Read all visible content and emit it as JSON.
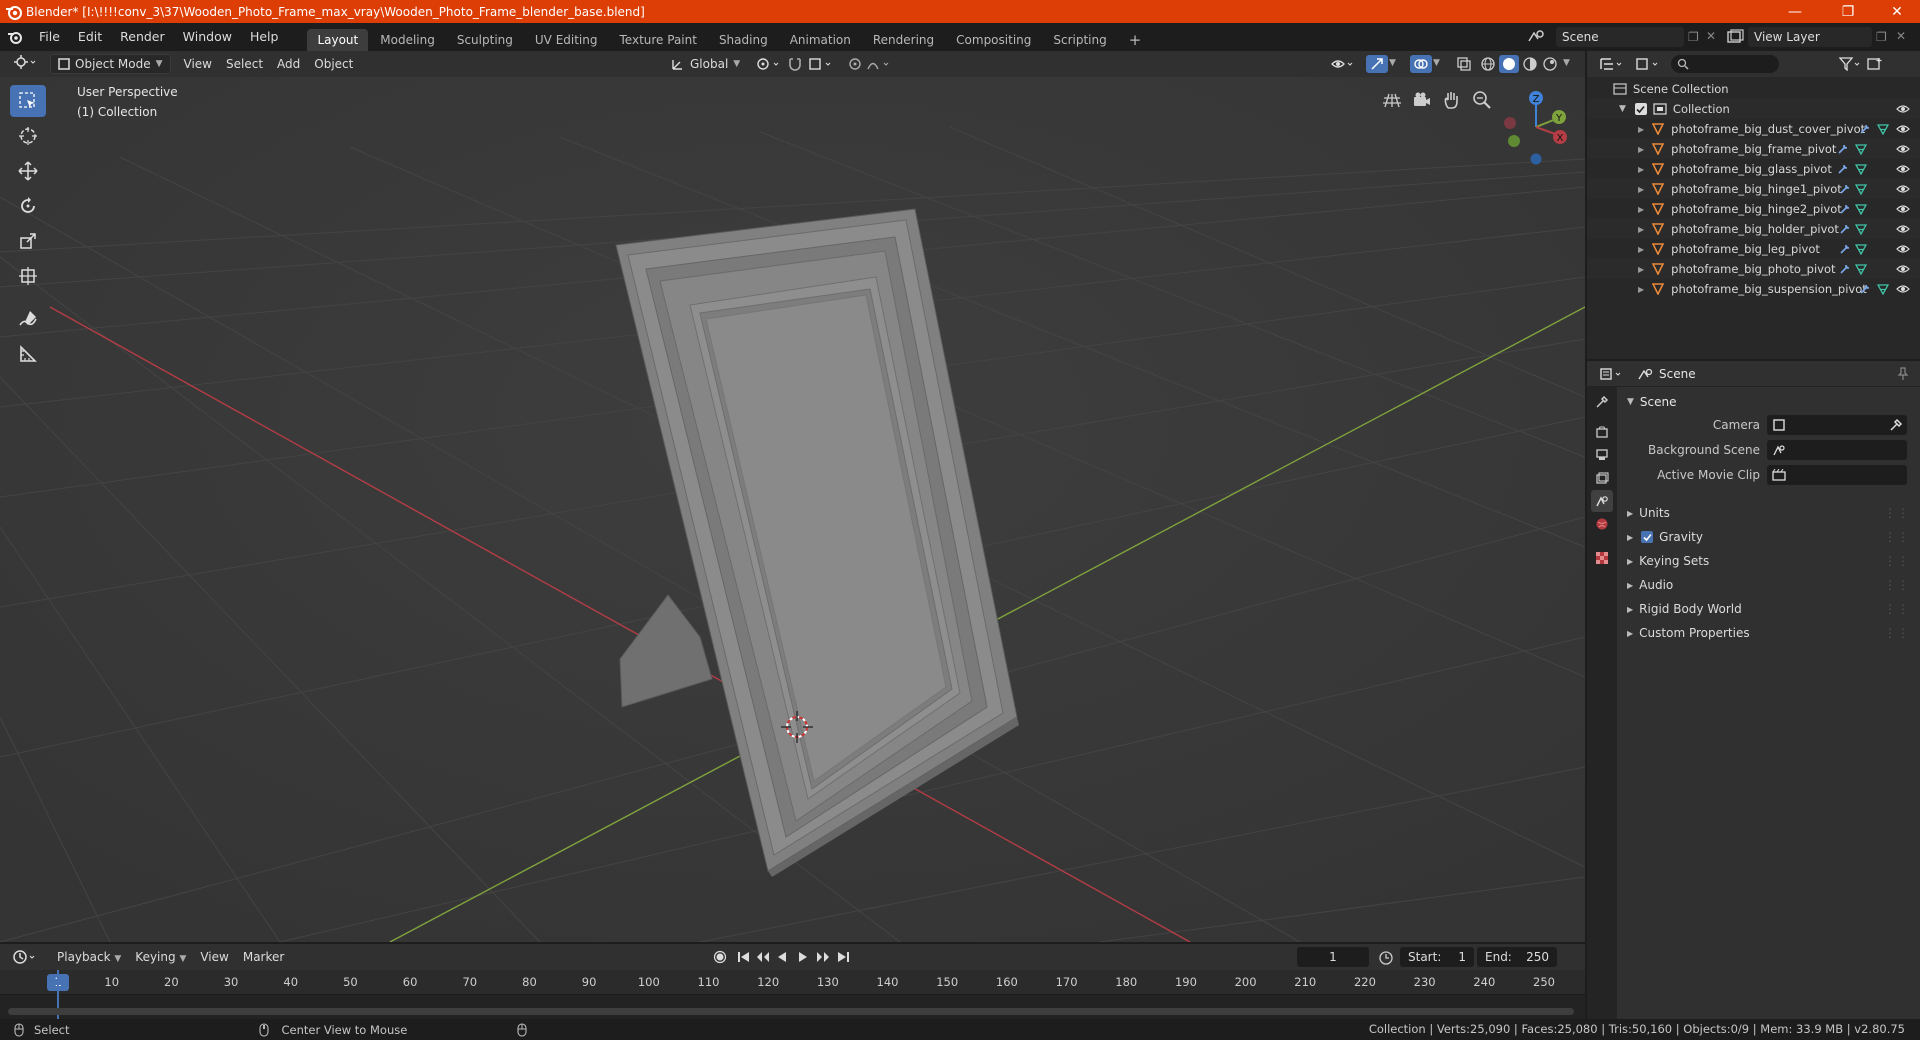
{
  "window": {
    "title": "Blender* [I:\\!!!!conv_3\\37\\Wooden_Photo_Frame_max_vray\\Wooden_Photo_Frame_blender_base.blend]",
    "minimize": "—",
    "maximize": "❐",
    "close": "✕"
  },
  "menubar": {
    "items": [
      "File",
      "Edit",
      "Render",
      "Window",
      "Help"
    ],
    "workspaces": [
      "Layout",
      "Modeling",
      "Sculpting",
      "UV Editing",
      "Texture Paint",
      "Shading",
      "Animation",
      "Rendering",
      "Compositing",
      "Scripting"
    ],
    "active_workspace": "Layout",
    "add_workspace": "+",
    "scene": "Scene",
    "view_layer": "View Layer"
  },
  "viewport_header": {
    "mode": "Object Mode",
    "menus": [
      "View",
      "Select",
      "Add",
      "Object"
    ],
    "orientation": "Global"
  },
  "viewport": {
    "perspective_label": "User Perspective",
    "collection_label": "(1) Collection",
    "gizmo_axes": [
      "Z",
      "Y",
      "X"
    ]
  },
  "outliner": {
    "search_placeholder": "",
    "scene_collection": "Scene Collection",
    "collection": "Collection",
    "objects": [
      "photoframe_big_dust_cover_pivot",
      "photoframe_big_frame_pivot",
      "photoframe_big_glass_pivot",
      "photoframe_big_hinge1_pivot",
      "photoframe_big_hinge2_pivot",
      "photoframe_big_holder_pivot",
      "photoframe_big_leg_pivot",
      "photoframe_big_photo_pivot",
      "photoframe_big_suspension_pivot"
    ]
  },
  "properties": {
    "context": "Scene",
    "panel_title": "Scene",
    "fields": [
      {
        "label": "Camera",
        "value": ""
      },
      {
        "label": "Background Scene",
        "value": ""
      },
      {
        "label": "Active Movie Clip",
        "value": ""
      }
    ],
    "panels": [
      "Units",
      "Gravity",
      "Keying Sets",
      "Audio",
      "Rigid Body World",
      "Custom Properties"
    ],
    "gravity_checked": true
  },
  "timeline": {
    "menus": [
      "Playback",
      "Keying",
      "View",
      "Marker"
    ],
    "current_frame": "1",
    "start_label": "Start:",
    "start": "1",
    "end_label": "End:",
    "end": "250",
    "ruler": [
      "1",
      "10",
      "20",
      "30",
      "40",
      "50",
      "60",
      "70",
      "80",
      "90",
      "100",
      "110",
      "120",
      "130",
      "140",
      "150",
      "160",
      "170",
      "180",
      "190",
      "200",
      "210",
      "220",
      "230",
      "240",
      "250"
    ]
  },
  "statusbar": {
    "select": "Select",
    "center_view": "Center View to Mouse",
    "stats": "Collection | Verts:25,090 | Faces:25,080 | Tris:50,160 | Objects:0/9 | Mem: 33.9 MB | v2.80.75"
  },
  "colors": {
    "titlebar": "#dc3e06",
    "accent": "#4772b3",
    "object_icon": "#e8893a",
    "x_axis": "#b53d45",
    "y_axis": "#7fa33c",
    "z_axis": "#3f82d8"
  }
}
